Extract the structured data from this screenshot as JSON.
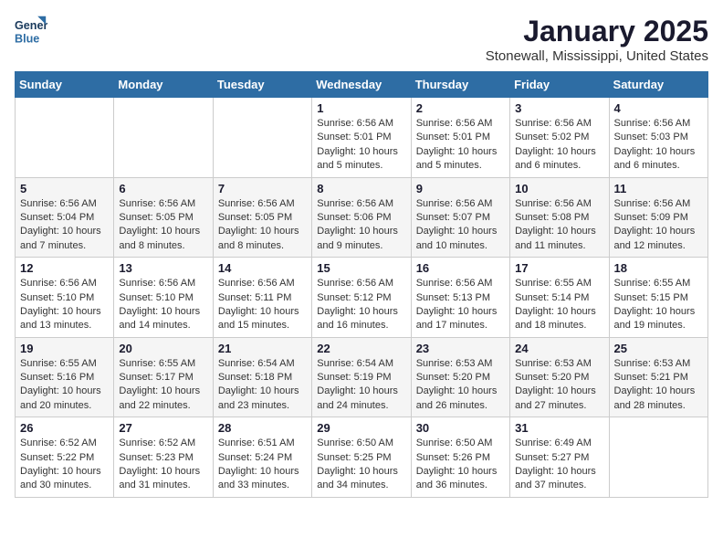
{
  "header": {
    "logo_line1": "General",
    "logo_line2": "Blue",
    "month_title": "January 2025",
    "location": "Stonewall, Mississippi, United States"
  },
  "days_of_week": [
    "Sunday",
    "Monday",
    "Tuesday",
    "Wednesday",
    "Thursday",
    "Friday",
    "Saturday"
  ],
  "weeks": [
    [
      {
        "day": "",
        "info": ""
      },
      {
        "day": "",
        "info": ""
      },
      {
        "day": "",
        "info": ""
      },
      {
        "day": "1",
        "info": "Sunrise: 6:56 AM\nSunset: 5:01 PM\nDaylight: 10 hours\nand 5 minutes."
      },
      {
        "day": "2",
        "info": "Sunrise: 6:56 AM\nSunset: 5:01 PM\nDaylight: 10 hours\nand 5 minutes."
      },
      {
        "day": "3",
        "info": "Sunrise: 6:56 AM\nSunset: 5:02 PM\nDaylight: 10 hours\nand 6 minutes."
      },
      {
        "day": "4",
        "info": "Sunrise: 6:56 AM\nSunset: 5:03 PM\nDaylight: 10 hours\nand 6 minutes."
      }
    ],
    [
      {
        "day": "5",
        "info": "Sunrise: 6:56 AM\nSunset: 5:04 PM\nDaylight: 10 hours\nand 7 minutes."
      },
      {
        "day": "6",
        "info": "Sunrise: 6:56 AM\nSunset: 5:05 PM\nDaylight: 10 hours\nand 8 minutes."
      },
      {
        "day": "7",
        "info": "Sunrise: 6:56 AM\nSunset: 5:05 PM\nDaylight: 10 hours\nand 8 minutes."
      },
      {
        "day": "8",
        "info": "Sunrise: 6:56 AM\nSunset: 5:06 PM\nDaylight: 10 hours\nand 9 minutes."
      },
      {
        "day": "9",
        "info": "Sunrise: 6:56 AM\nSunset: 5:07 PM\nDaylight: 10 hours\nand 10 minutes."
      },
      {
        "day": "10",
        "info": "Sunrise: 6:56 AM\nSunset: 5:08 PM\nDaylight: 10 hours\nand 11 minutes."
      },
      {
        "day": "11",
        "info": "Sunrise: 6:56 AM\nSunset: 5:09 PM\nDaylight: 10 hours\nand 12 minutes."
      }
    ],
    [
      {
        "day": "12",
        "info": "Sunrise: 6:56 AM\nSunset: 5:10 PM\nDaylight: 10 hours\nand 13 minutes."
      },
      {
        "day": "13",
        "info": "Sunrise: 6:56 AM\nSunset: 5:10 PM\nDaylight: 10 hours\nand 14 minutes."
      },
      {
        "day": "14",
        "info": "Sunrise: 6:56 AM\nSunset: 5:11 PM\nDaylight: 10 hours\nand 15 minutes."
      },
      {
        "day": "15",
        "info": "Sunrise: 6:56 AM\nSunset: 5:12 PM\nDaylight: 10 hours\nand 16 minutes."
      },
      {
        "day": "16",
        "info": "Sunrise: 6:56 AM\nSunset: 5:13 PM\nDaylight: 10 hours\nand 17 minutes."
      },
      {
        "day": "17",
        "info": "Sunrise: 6:55 AM\nSunset: 5:14 PM\nDaylight: 10 hours\nand 18 minutes."
      },
      {
        "day": "18",
        "info": "Sunrise: 6:55 AM\nSunset: 5:15 PM\nDaylight: 10 hours\nand 19 minutes."
      }
    ],
    [
      {
        "day": "19",
        "info": "Sunrise: 6:55 AM\nSunset: 5:16 PM\nDaylight: 10 hours\nand 20 minutes."
      },
      {
        "day": "20",
        "info": "Sunrise: 6:55 AM\nSunset: 5:17 PM\nDaylight: 10 hours\nand 22 minutes."
      },
      {
        "day": "21",
        "info": "Sunrise: 6:54 AM\nSunset: 5:18 PM\nDaylight: 10 hours\nand 23 minutes."
      },
      {
        "day": "22",
        "info": "Sunrise: 6:54 AM\nSunset: 5:19 PM\nDaylight: 10 hours\nand 24 minutes."
      },
      {
        "day": "23",
        "info": "Sunrise: 6:53 AM\nSunset: 5:20 PM\nDaylight: 10 hours\nand 26 minutes."
      },
      {
        "day": "24",
        "info": "Sunrise: 6:53 AM\nSunset: 5:20 PM\nDaylight: 10 hours\nand 27 minutes."
      },
      {
        "day": "25",
        "info": "Sunrise: 6:53 AM\nSunset: 5:21 PM\nDaylight: 10 hours\nand 28 minutes."
      }
    ],
    [
      {
        "day": "26",
        "info": "Sunrise: 6:52 AM\nSunset: 5:22 PM\nDaylight: 10 hours\nand 30 minutes."
      },
      {
        "day": "27",
        "info": "Sunrise: 6:52 AM\nSunset: 5:23 PM\nDaylight: 10 hours\nand 31 minutes."
      },
      {
        "day": "28",
        "info": "Sunrise: 6:51 AM\nSunset: 5:24 PM\nDaylight: 10 hours\nand 33 minutes."
      },
      {
        "day": "29",
        "info": "Sunrise: 6:50 AM\nSunset: 5:25 PM\nDaylight: 10 hours\nand 34 minutes."
      },
      {
        "day": "30",
        "info": "Sunrise: 6:50 AM\nSunset: 5:26 PM\nDaylight: 10 hours\nand 36 minutes."
      },
      {
        "day": "31",
        "info": "Sunrise: 6:49 AM\nSunset: 5:27 PM\nDaylight: 10 hours\nand 37 minutes."
      },
      {
        "day": "",
        "info": ""
      }
    ]
  ]
}
